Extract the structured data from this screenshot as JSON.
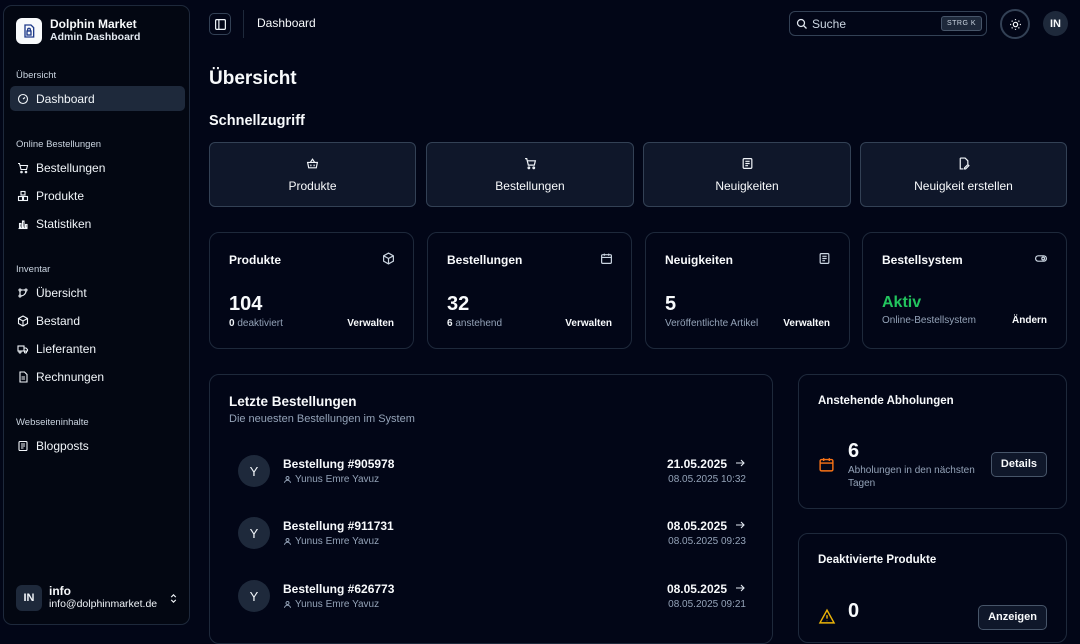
{
  "brand": {
    "name": "Dolphin Market",
    "subtitle": "Admin Dashboard"
  },
  "sidebar": {
    "groups": [
      {
        "label": "Übersicht",
        "items": [
          {
            "label": "Dashboard",
            "icon": "gauge-icon",
            "active": true
          }
        ]
      },
      {
        "label": "Online Bestellungen",
        "items": [
          {
            "label": "Bestellungen",
            "icon": "cart-icon"
          },
          {
            "label": "Produkte",
            "icon": "boxes-icon"
          },
          {
            "label": "Statistiken",
            "icon": "bar-chart-icon"
          }
        ]
      },
      {
        "label": "Inventar",
        "items": [
          {
            "label": "Übersicht",
            "icon": "workflow-icon"
          },
          {
            "label": "Bestand",
            "icon": "package-icon"
          },
          {
            "label": "Lieferanten",
            "icon": "truck-icon"
          },
          {
            "label": "Rechnungen",
            "icon": "file-text-icon"
          }
        ]
      },
      {
        "label": "Webseiteninhalte",
        "items": [
          {
            "label": "Blogposts",
            "icon": "newspaper-icon"
          }
        ]
      }
    ],
    "user": {
      "initials": "IN",
      "name": "info",
      "email": "info@dolphinmarket.de"
    }
  },
  "topbar": {
    "title": "Dashboard",
    "search_placeholder": "Suche",
    "shortcut": "STRG K",
    "avatar": "IN"
  },
  "page": {
    "title": "Übersicht",
    "quick_title": "Schnellzugriff"
  },
  "quick_actions": [
    {
      "label": "Produkte",
      "icon": "basket-icon"
    },
    {
      "label": "Bestellungen",
      "icon": "cart-icon"
    },
    {
      "label": "Neuigkeiten",
      "icon": "newspaper-icon"
    },
    {
      "label": "Neuigkeit erstellen",
      "icon": "file-pen-icon"
    }
  ],
  "stats": [
    {
      "title": "Produkte",
      "value": "104",
      "sub_strong": "0",
      "sub_text": " deaktiviert",
      "link": "Verwalten",
      "icon": "package-open-icon"
    },
    {
      "title": "Bestellungen",
      "value": "32",
      "sub_strong": "6",
      "sub_text": " anstehend",
      "link": "Verwalten",
      "icon": "calendar-icon"
    },
    {
      "title": "Neuigkeiten",
      "value": "5",
      "sub_strong": "",
      "sub_text": "Veröffentlichte Artikel",
      "link": "Verwalten",
      "icon": "newspaper-icon"
    },
    {
      "title": "Bestellsystem",
      "value": "Aktiv",
      "sub_strong": "",
      "sub_text": "Online-Bestellsystem",
      "link": "Ändern",
      "icon": "toggle-icon"
    }
  ],
  "orders": {
    "title": "Letzte Bestellungen",
    "subtitle": "Die neuesten Bestellungen im System",
    "rows": [
      {
        "initial": "Y",
        "number": "Bestellung #905978",
        "customer": "Yunus Emre Yavuz",
        "date": "21.05.2025",
        "created": "08.05.2025 10:32"
      },
      {
        "initial": "Y",
        "number": "Bestellung #911731",
        "customer": "Yunus Emre Yavuz",
        "date": "08.05.2025",
        "created": "08.05.2025 09:23"
      },
      {
        "initial": "Y",
        "number": "Bestellung #626773",
        "customer": "Yunus Emre Yavuz",
        "date": "08.05.2025",
        "created": "08.05.2025 09:21"
      }
    ]
  },
  "pickups": {
    "title": "Anstehende Abholungen",
    "value": "6",
    "text": "Abholungen in den nächsten Tagen",
    "button": "Details"
  },
  "deactivated": {
    "title": "Deaktivierte Produkte",
    "value": "0",
    "button": "Anzeigen"
  },
  "colors": {
    "background": "#020617",
    "accent_green": "#22c55e",
    "accent_orange": "#f97316",
    "warning_yellow": "#eab308"
  }
}
